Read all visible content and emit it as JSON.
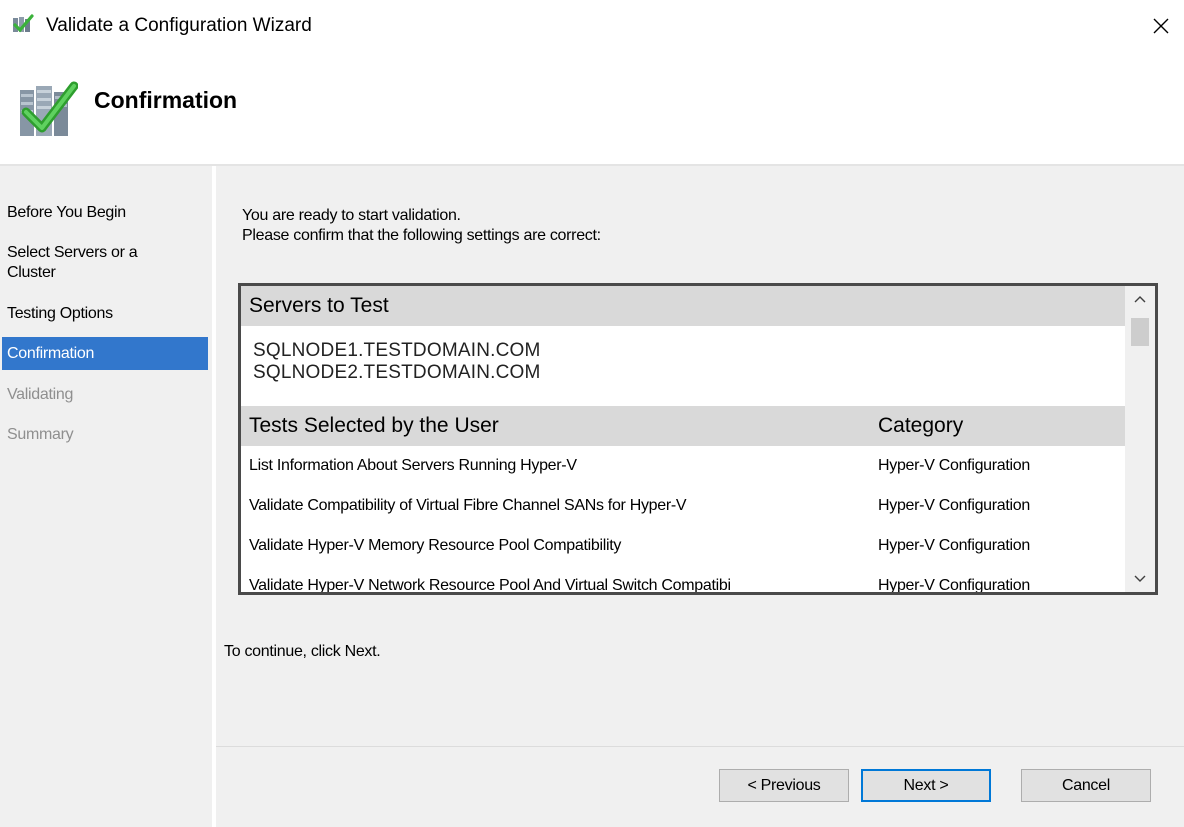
{
  "window": {
    "title": "Validate a Configuration Wizard"
  },
  "header": {
    "title": "Confirmation"
  },
  "sidebar": {
    "items": [
      {
        "label": "Before You Begin",
        "state": "normal"
      },
      {
        "label_line1": "Select Servers or a",
        "label_line2": "Cluster",
        "state": "normal"
      },
      {
        "label": "Testing Options",
        "state": "normal"
      },
      {
        "label": "Confirmation",
        "state": "active"
      },
      {
        "label": "Validating",
        "state": "disabled"
      },
      {
        "label": "Summary",
        "state": "disabled"
      }
    ]
  },
  "main": {
    "intro_line1": "You are ready to start validation.",
    "intro_line2": "Please confirm that the following settings are correct:",
    "servers_header": "Servers to Test",
    "servers": [
      "SQLNODE1.TESTDOMAIN.COM",
      "SQLNODE2.TESTDOMAIN.COM"
    ],
    "tests_header": "Tests Selected by the User",
    "category_header": "Category",
    "tests": [
      {
        "name": "List Information About Servers Running Hyper-V",
        "category": "Hyper-V Configuration"
      },
      {
        "name": "Validate Compatibility of Virtual Fibre Channel SANs for Hyper-V",
        "category": "Hyper-V Configuration"
      },
      {
        "name": "Validate Hyper-V Memory Resource Pool Compatibility",
        "category": "Hyper-V Configuration"
      },
      {
        "name": "Validate Hyper-V Network Resource Pool And Virtual Switch Compatibi",
        "category": "Hyper-V Configuration"
      }
    ],
    "continue_text": "To continue, click Next."
  },
  "buttons": {
    "previous": "< Previous",
    "next": "Next >",
    "cancel": "Cancel"
  },
  "colors": {
    "selected_nav": "#3277cc",
    "default_button_border": "#0078d7",
    "check_green": "#3ab23a"
  }
}
